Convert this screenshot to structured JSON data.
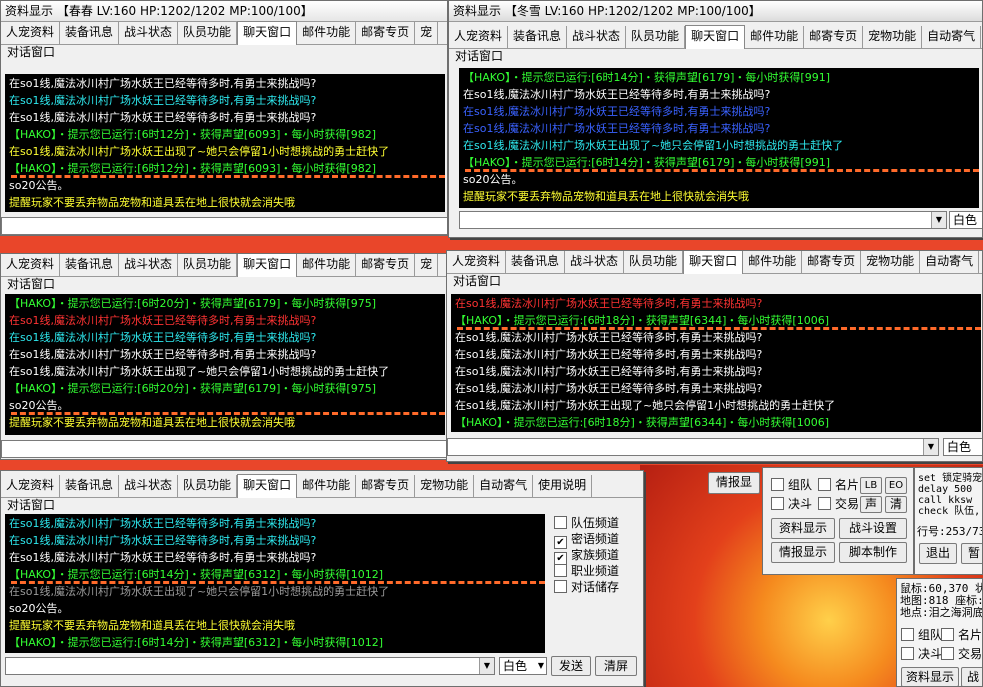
{
  "tabs_a": [
    "人宠资料",
    "装备讯息",
    "战斗状态",
    "队员功能",
    "聊天窗口",
    "邮件功能",
    "邮寄专页",
    "宠"
  ],
  "tabs_b": [
    "人宠资料",
    "装备讯息",
    "战斗状态",
    "队员功能",
    "聊天窗口",
    "邮件功能",
    "邮寄专页",
    "宠物功能",
    "自动寄气"
  ],
  "tabs_c": [
    "人宠资料",
    "装备讯息",
    "战斗状态",
    "队员功能",
    "聊天窗口",
    "邮件功能",
    "邮寄专页",
    "宠"
  ],
  "tabs_d": [
    "人宠资料",
    "装备讯息",
    "战斗状态",
    "队员功能",
    "聊天窗口",
    "邮件功能",
    "邮寄专页",
    "宠物功能",
    "自动寄气"
  ],
  "tabs_e": [
    "人宠资料",
    "装备讯息",
    "战斗状态",
    "队员功能",
    "聊天窗口",
    "邮件功能",
    "邮寄专页",
    "宠物功能",
    "自动寄气",
    "使用说明"
  ],
  "group_label": "对话窗口",
  "win_a": {
    "title": "资料显示  【春春  LV:160  HP:1202/1202  MP:100/100】",
    "lines": [
      {
        "c": "c-white",
        "t": "在so1线,魔法冰川村广场水妖王已经等待多时,有勇士来挑战吗?"
      },
      {
        "c": "c-cyan",
        "t": "在so1线,魔法冰川村广场水妖王已经等待多时,有勇士来挑战吗?"
      },
      {
        "c": "c-white",
        "t": "在so1线,魔法冰川村广场水妖王已经等待多时,有勇士来挑战吗?"
      },
      {
        "c": "c-green",
        "t": "【HAKO】・提示您已运行:[6时12分]・获得声望[6093]・每小时获得[982]"
      },
      {
        "c": "c-yellow",
        "t": "在so1线,魔法冰川村广场水妖王出现了~她只会停留1小时想挑战的勇士赶快了"
      },
      {
        "c": "c-green",
        "t": "【HAKO】・提示您已运行:[6时12分]・获得声望[6093]・每小时获得[982]",
        "u": true
      },
      {
        "c": "c-white",
        "t": "so20公告。"
      },
      {
        "c": "c-yellow",
        "t": "提醒玩家不要丢弃物品宠物和道具丢在地上很快就会消失哦"
      }
    ]
  },
  "win_b": {
    "title": "资料显示  【冬雪  LV:160  HP:1202/1202  MP:100/100】",
    "color_select": "白色",
    "lines": [
      {
        "c": "c-green",
        "t": "【HAKO】・提示您已运行:[6时14分]・获得声望[6179]・每小时获得[991]"
      },
      {
        "c": "c-white",
        "t": "在so1线,魔法冰川村广场水妖王已经等待多时,有勇士来挑战吗?"
      },
      {
        "c": "c-blue",
        "t": "在so1线,魔法冰川村广场水妖王已经等待多时,有勇士来挑战吗?"
      },
      {
        "c": "c-blue",
        "t": "在so1线,魔法冰川村广场水妖王已经等待多时,有勇士来挑战吗?"
      },
      {
        "c": "c-cyan",
        "t": "在so1线,魔法冰川村广场水妖王出现了~她只会停留1小时想挑战的勇士赶快了"
      },
      {
        "c": "c-green",
        "t": "【HAKO】・提示您已运行:[6时14分]・获得声望[6179]・每小时获得[991]",
        "u": true
      },
      {
        "c": "c-white",
        "t": "so20公告。"
      },
      {
        "c": "c-yellow",
        "t": "提醒玩家不要丢弃物品宠物和道具丢在地上很快就会消失哦"
      }
    ]
  },
  "win_c": {
    "lines": [
      {
        "c": "c-green",
        "t": "【HAKO】・提示您已运行:[6时20分]・获得声望[6179]・每小时获得[975]"
      },
      {
        "c": "c-red",
        "t": "在so1线,魔法冰川村广场水妖王已经等待多时,有勇士来挑战吗?"
      },
      {
        "c": "c-cyan",
        "t": "在so1线,魔法冰川村广场水妖王已经等待多时,有勇士来挑战吗?"
      },
      {
        "c": "c-white",
        "t": "在so1线,魔法冰川村广场水妖王已经等待多时,有勇士来挑战吗?"
      },
      {
        "c": "c-white",
        "t": "在so1线,魔法冰川村广场水妖王出现了~她只会停留1小时想挑战的勇士赶快了"
      },
      {
        "c": "c-green",
        "t": "【HAKO】・提示您已运行:[6时20分]・获得声望[6179]・每小时获得[975]"
      },
      {
        "c": "c-white",
        "t": "so20公告。",
        "u": true
      },
      {
        "c": "c-yellow",
        "t": "提醒玩家不要丢弃物品宠物和道具丢在地上很快就会消失哦"
      }
    ]
  },
  "win_d": {
    "color_select": "白色",
    "lines": [
      {
        "c": "c-red",
        "t": "在so1线,魔法冰川村广场水妖王已经等待多时,有勇士来挑战吗?"
      },
      {
        "c": "c-green",
        "t": "【HAKO】・提示您已运行:[6时18分]・获得声望[6344]・每小时获得[1006]",
        "u": true
      },
      {
        "c": "c-white",
        "t": "在so1线,魔法冰川村广场水妖王已经等待多时,有勇士来挑战吗?"
      },
      {
        "c": "c-white",
        "t": "在so1线,魔法冰川村广场水妖王已经等待多时,有勇士来挑战吗?"
      },
      {
        "c": "c-white",
        "t": "在so1线,魔法冰川村广场水妖王已经等待多时,有勇士来挑战吗?"
      },
      {
        "c": "c-white",
        "t": "在so1线,魔法冰川村广场水妖王已经等待多时,有勇士来挑战吗?"
      },
      {
        "c": "c-white",
        "t": "在so1线,魔法冰川村广场水妖王出现了~她只会停留1小时想挑战的勇士赶快了"
      },
      {
        "c": "c-green",
        "t": "【HAKO】・提示您已运行:[6时18分]・获得声望[6344]・每小时获得[1006]"
      }
    ]
  },
  "win_e": {
    "color_select": "白色",
    "send_label": "发送",
    "clear_label": "清屏",
    "channels": [
      {
        "label": "队伍频道",
        "checked": false
      },
      {
        "label": "密语频道",
        "checked": true
      },
      {
        "label": "家族频道",
        "checked": true
      },
      {
        "label": "职业频道",
        "checked": false
      },
      {
        "label": "对话储存",
        "checked": false
      }
    ],
    "lines": [
      {
        "c": "c-cyan",
        "t": "在so1线,魔法冰川村广场水妖王已经等待多时,有勇士来挑战吗?"
      },
      {
        "c": "c-cyan",
        "t": "在so1线,魔法冰川村广场水妖王已经等待多时,有勇士来挑战吗?"
      },
      {
        "c": "c-white",
        "t": "在so1线,魔法冰川村广场水妖王已经等待多时,有勇士来挑战吗?"
      },
      {
        "c": "c-green",
        "t": "【HAKO】・提示您已运行:[6时14分]・获得声望[6312]・每小时获得[1012]",
        "u": true
      },
      {
        "c": "c-gray",
        "t": "在so1线,魔法冰川村广场水妖王出现了~她只会停留1小时想挑战的勇士赶快了"
      },
      {
        "c": "c-white",
        "t": "so20公告。"
      },
      {
        "c": "c-yellow",
        "t": "提醒玩家不要丢弃物品宠物和道具丢在地上很快就会消失哦"
      },
      {
        "c": "c-green",
        "t": "【HAKO】・提示您已运行:[6时14分]・获得声望[6312]・每小时获得[1012]"
      }
    ]
  },
  "panel_f": {
    "info_btn": "情报显",
    "team": "组队",
    "card": "名片",
    "lb": "LB",
    "eo": "EO",
    "duel": "决斗",
    "trade": "交易",
    "voice": "声",
    "clear": "清",
    "data_btn": "资料显示",
    "battle_btn": "战斗设置",
    "intel_btn": "情报显示",
    "script_btn": "脚本制作",
    "exit_btn": "退出",
    "pause_btn": "暂"
  },
  "panel_g": {
    "script_lines": [
      "set 锁定骑宠",
      "delay 500",
      "call kksw",
      "check 队伍,"
    ],
    "line_no": "行号:253/73",
    "coords": [
      "鼠标:60,370 状",
      "地图:818 座标:",
      "地点:泪之海洞底"
    ],
    "team": "组队",
    "card": "名片",
    "duel": "决斗",
    "trade": "交易",
    "data_btn": "资料显示",
    "battle_btn": "战"
  }
}
